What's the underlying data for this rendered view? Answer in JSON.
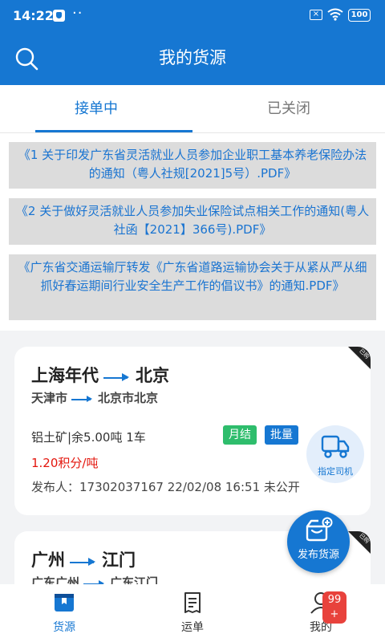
{
  "status": {
    "time": "14:22",
    "battery": "100"
  },
  "header": {
    "title": "我的货源"
  },
  "tabs": [
    {
      "label": "接单中"
    },
    {
      "label": "已关闭"
    }
  ],
  "notices": [
    "《1 关于印发广东省灵活就业人员参加企业职工基本养老保险办法的通知（粤人社规[2021]5号）.PDF》",
    "《2 关于做好灵活就业人员参加失业保险试点相关工作的通知(粤人社函【2021】366号).PDF》",
    "《广东省交通运输厅转发《广东省道路运输协会关于从紧从严从细抓好春运期间行业安全生产工作的倡议书》的通知.PDF》"
  ],
  "cards": [
    {
      "corner": "已购",
      "from": "上海年代",
      "to": "北京",
      "from_sub": "天津市",
      "to_sub": "北京市北京",
      "cargo": "铝土矿|余5.00吨 1车",
      "tag1": "月结",
      "tag2": "批量",
      "price": "1.20积分/吨",
      "publisher": "发布人：17302037167 22/02/08 16:51 未公开",
      "assign_label": "指定司机"
    },
    {
      "corner": "已购",
      "from": "广州",
      "to": "江门",
      "from_sub": "广东广州",
      "to_sub": "广东江门"
    }
  ],
  "fab": {
    "label": "发布货源"
  },
  "bottom_nav": [
    {
      "label": "货源"
    },
    {
      "label": "运单"
    },
    {
      "label": "我的"
    }
  ],
  "badge": {
    "line1": "99",
    "line2": "+"
  },
  "colors": {
    "primary": "#1677d2",
    "price": "#e3150c",
    "green_tag": "#2ebd6c",
    "badge": "#e8423c"
  }
}
